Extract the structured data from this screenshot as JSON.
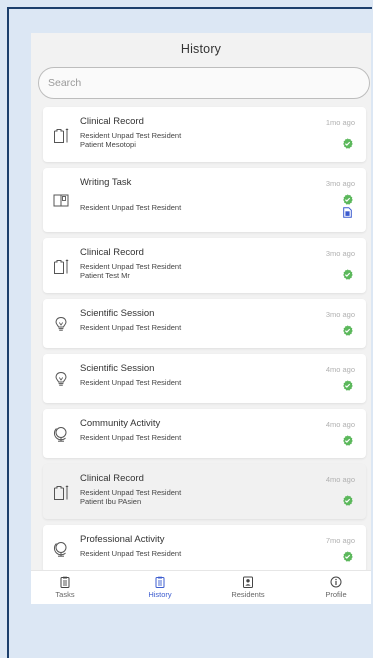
{
  "header": {
    "title": "History"
  },
  "search": {
    "placeholder": "Search"
  },
  "items": [
    {
      "icon": "clinical-record-icon",
      "title": "Clinical Record",
      "line1": "Resident Unpad Test Resident",
      "line2": "Patient Mesotopi",
      "time": "1mo ago",
      "status": "verified"
    },
    {
      "icon": "book-icon",
      "title": "Writing Task",
      "line1": "Resident Unpad Test Resident",
      "line2": "",
      "time": "3mo ago",
      "status": "verified",
      "attachment": "document-icon"
    },
    {
      "icon": "clinical-record-icon",
      "title": "Clinical Record",
      "line1": "Resident Unpad Test Resident",
      "line2": "Patient Test Mr",
      "time": "3mo ago",
      "status": "verified"
    },
    {
      "icon": "lightbulb-icon",
      "title": "Scientific Session",
      "line1": "Resident Unpad Test Resident",
      "line2": "",
      "time": "3mo ago",
      "status": "verified"
    },
    {
      "icon": "lightbulb-icon",
      "title": "Scientific Session",
      "line1": "Resident Unpad Test Resident",
      "line2": "",
      "time": "4mo ago",
      "status": "verified"
    },
    {
      "icon": "globe-icon",
      "title": "Community Activity",
      "line1": "Resident Unpad Test Resident",
      "line2": "",
      "time": "4mo ago",
      "status": "verified"
    },
    {
      "icon": "clinical-record-icon",
      "title": "Clinical Record",
      "line1": "Resident Unpad Test Resident",
      "line2": "Patient Ibu PAsien",
      "time": "4mo ago",
      "status": "verified"
    },
    {
      "icon": "globe-icon",
      "title": "Professional Activity",
      "line1": "Resident Unpad Test Resident",
      "line2": "",
      "time": "7mo ago",
      "status": "verified"
    }
  ],
  "tabs": [
    {
      "label": "Tasks",
      "icon": "clipboard-icon",
      "active": false
    },
    {
      "label": "History",
      "icon": "clipboard-list-icon",
      "active": true
    },
    {
      "label": "Residents",
      "icon": "id-badge-icon",
      "active": false
    },
    {
      "label": "Profile",
      "icon": "info-circle-icon",
      "active": false
    }
  ],
  "colors": {
    "accent": "#3c5ccf",
    "verified": "#5cb85c",
    "background": "#dce7f4",
    "frame": "#1d3f6c"
  }
}
